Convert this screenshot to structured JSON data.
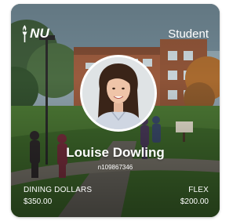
{
  "card": {
    "logo_text": "NU",
    "role": "Student",
    "student_name": "Louise Dowling",
    "student_id": "n109867346",
    "balances": [
      {
        "label": "DINING DOLLARS",
        "amount": "$350.00"
      },
      {
        "label": "FLEX",
        "amount": "$200.00"
      }
    ]
  },
  "colors": {
    "text": "#ffffff",
    "avatar_border": "#ffffff"
  },
  "icons": {
    "logo": "torch-icon"
  }
}
